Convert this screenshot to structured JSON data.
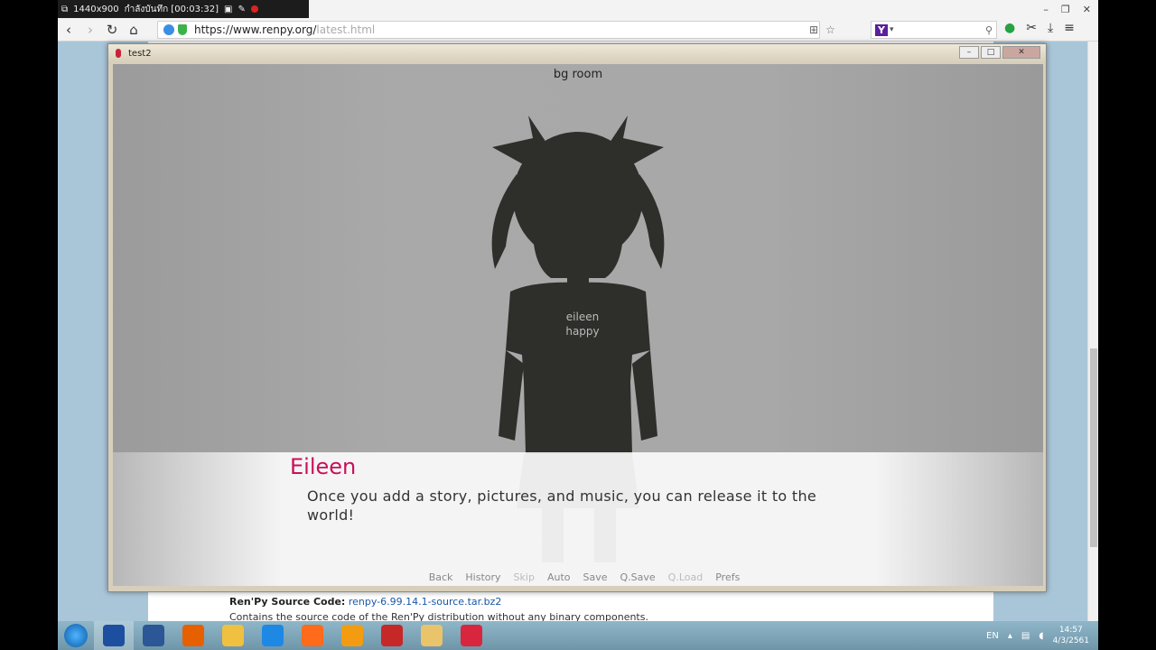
{
  "recorder": {
    "resolution": "1440x900",
    "status": "กำลังบันทึก [00:03:32]"
  },
  "browser": {
    "url_main": "https://www.renpy.org/",
    "url_faded": "latest.html"
  },
  "page": {
    "source_label": "Ren'Py Source Code:",
    "source_link": "renpy-6.99.14.1-source.tar.bz2",
    "source_desc": "Contains the source code of the Ren'Py distribution without any binary components."
  },
  "game": {
    "window_title": "test2",
    "bg_label": "bg room",
    "sprite_label_1": "eileen",
    "sprite_label_2": "happy",
    "speaker": "Eileen",
    "dialogue": "Once you add a story, pictures, and music, you can release it to the world!",
    "quick_menu": [
      {
        "label": "Back",
        "enabled": true
      },
      {
        "label": "History",
        "enabled": true
      },
      {
        "label": "Skip",
        "enabled": false
      },
      {
        "label": "Auto",
        "enabled": true
      },
      {
        "label": "Save",
        "enabled": true
      },
      {
        "label": "Q.Save",
        "enabled": true
      },
      {
        "label": "Q.Load",
        "enabled": false
      },
      {
        "label": "Prefs",
        "enabled": true
      }
    ]
  },
  "taskbar": {
    "lang": "EN",
    "time": "14:57",
    "date": "4/3/2561",
    "app_colors": [
      "#1d4fa0",
      "#2b5797",
      "#e66000",
      "#f0c040",
      "#1e88e5",
      "#ff6b1a",
      "#f39c12",
      "#c62828",
      "#e9c46a",
      "#d7263d"
    ]
  },
  "colors": {
    "speaker": "#c8105a",
    "silhouette": "#2e2e2b"
  }
}
